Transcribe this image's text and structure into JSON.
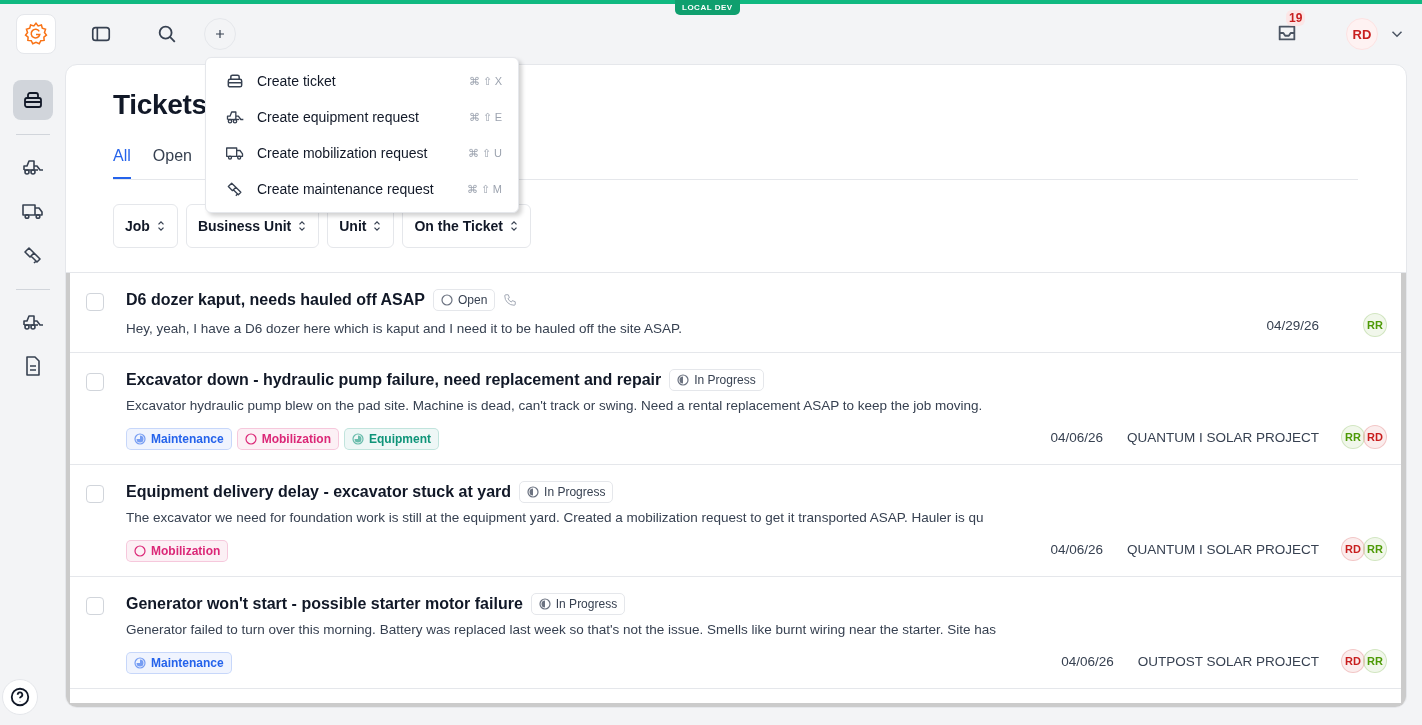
{
  "env_badge": "LOCAL DEV",
  "top_bar": {
    "notifications": "19",
    "user_initials": "RD"
  },
  "create_menu": [
    {
      "kind": "ticket",
      "label": "Create ticket",
      "shortcut": "⌘ ⇧ X"
    },
    {
      "kind": "equipment",
      "label": "Create equipment request",
      "shortcut": "⌘ ⇧ E"
    },
    {
      "kind": "mobilization",
      "label": "Create mobilization request",
      "shortcut": "⌘ ⇧ U"
    },
    {
      "kind": "maintenance",
      "label": "Create maintenance request",
      "shortcut": "⌘ ⇧ M"
    }
  ],
  "sidebar": {
    "groups": [
      [
        {
          "kind": "ticket",
          "selected": true
        }
      ],
      [
        {
          "kind": "equipment",
          "selected": false
        },
        {
          "kind": "mobilization",
          "selected": false
        },
        {
          "kind": "maintenance",
          "selected": false
        }
      ],
      [
        {
          "kind": "equipment",
          "selected": false
        },
        {
          "kind": "document",
          "selected": false
        }
      ]
    ]
  },
  "page_title": "Tickets",
  "tabs": [
    {
      "label": "All",
      "selected": true
    },
    {
      "label": "Open",
      "selected": false
    }
  ],
  "filters": [
    "Job",
    "Business Unit",
    "Unit",
    "On the Ticket"
  ],
  "tickets": [
    {
      "title": "D6 dozer kaput, needs hauled off ASAP",
      "status": {
        "kind": "open",
        "label": "Open"
      },
      "phone": true,
      "checked": false,
      "description": "Hey, yeah, I have a D6 dozer here which is kaput and I need it to be hauled off the site ASAP.",
      "date": "04/29/26",
      "assignees": [
        {
          "initials": "RR",
          "color": "#4d9a06"
        }
      ]
    },
    {
      "title": "Excavator down - hydraulic pump failure, need replacement and repair",
      "status": {
        "kind": "in_progress",
        "label": "In Progress"
      },
      "phone": false,
      "checked": false,
      "description": "Excavator hydraulic pump blew on the pad site. Machine is dead, can't track or swing. Need a rental replacement ASAP to keep the job moving.",
      "tags": [
        {
          "kind": "maintenance",
          "label": "Maintenance",
          "color": "#2563eb"
        },
        {
          "kind": "mobilization",
          "label": "Mobilization",
          "color": "#db2777"
        },
        {
          "kind": "equipment",
          "label": "Equipment",
          "color": "#0f9479"
        }
      ],
      "date": "04/06/26",
      "project": "QUANTUM I SOLAR PROJECT",
      "assignees": [
        {
          "initials": "RR",
          "color": "#4d9a06"
        },
        {
          "initials": "RD",
          "color": "#c81e1e"
        }
      ]
    },
    {
      "title": "Equipment delivery delay - excavator stuck at yard",
      "status": {
        "kind": "in_progress",
        "label": "In Progress"
      },
      "phone": false,
      "checked": false,
      "description": "The excavator we need for foundation work is still at the equipment yard. Created a mobilization request to get it transported ASAP. Hauler is qu",
      "tags": [
        {
          "kind": "mobilization",
          "label": "Mobilization",
          "color": "#db2777"
        }
      ],
      "date": "04/06/26",
      "project": "QUANTUM I SOLAR PROJECT",
      "assignees": [
        {
          "initials": "RD",
          "color": "#c81e1e"
        },
        {
          "initials": "RR",
          "color": "#4d9a06"
        }
      ]
    },
    {
      "title": "Generator won't start - possible starter motor failure",
      "status": {
        "kind": "in_progress",
        "label": "In Progress"
      },
      "phone": false,
      "checked": false,
      "description": "Generator failed to turn over this morning. Battery was replaced last week so that's not the issue. Smells like burnt wiring near the starter. Site has",
      "tags": [
        {
          "kind": "maintenance",
          "label": "Maintenance",
          "color": "#2563eb"
        }
      ],
      "date": "04/06/26",
      "project": "OUTPOST SOLAR PROJECT",
      "assignees": [
        {
          "initials": "RD",
          "color": "#c81e1e"
        },
        {
          "initials": "RR",
          "color": "#4d9a06"
        }
      ]
    }
  ]
}
